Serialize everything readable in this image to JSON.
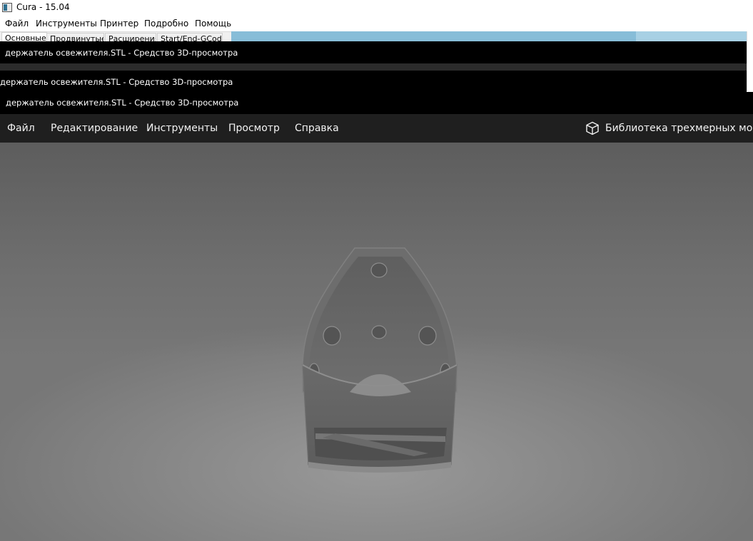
{
  "cura": {
    "title": "Cura - 15.04",
    "menu": [
      "Файл",
      "Инструменты",
      "Принтер",
      "Подробно",
      "Помощь"
    ],
    "tabs": [
      "Основные",
      "Продвинутые",
      "Расширения",
      "Start/End-GCode"
    ],
    "active_tab": "Основные"
  },
  "ghost_windows": [
    "держатель освежителя.STL - Средство 3D-просмотра",
    "держатель освежителя.STL - Средство 3D-просмотра"
  ],
  "viewer": {
    "title": "держатель освежителя.STL - Средство 3D-просмотра",
    "menu": [
      "Файл",
      "Редактирование",
      "Инструменты",
      "Просмотр",
      "Справка"
    ],
    "library_link": "Библиотека трехмерных моделей",
    "library_icon": "cube-outline-icon",
    "model_name": "держатель освежителя.STL"
  },
  "colors": {
    "titlebar_bg": "#000000",
    "menubar_bg": "#1f1f1f",
    "viewport_bg": "#7a7a7a",
    "model": "#6b6b6b",
    "cura_viewport": "#87bdd8"
  }
}
